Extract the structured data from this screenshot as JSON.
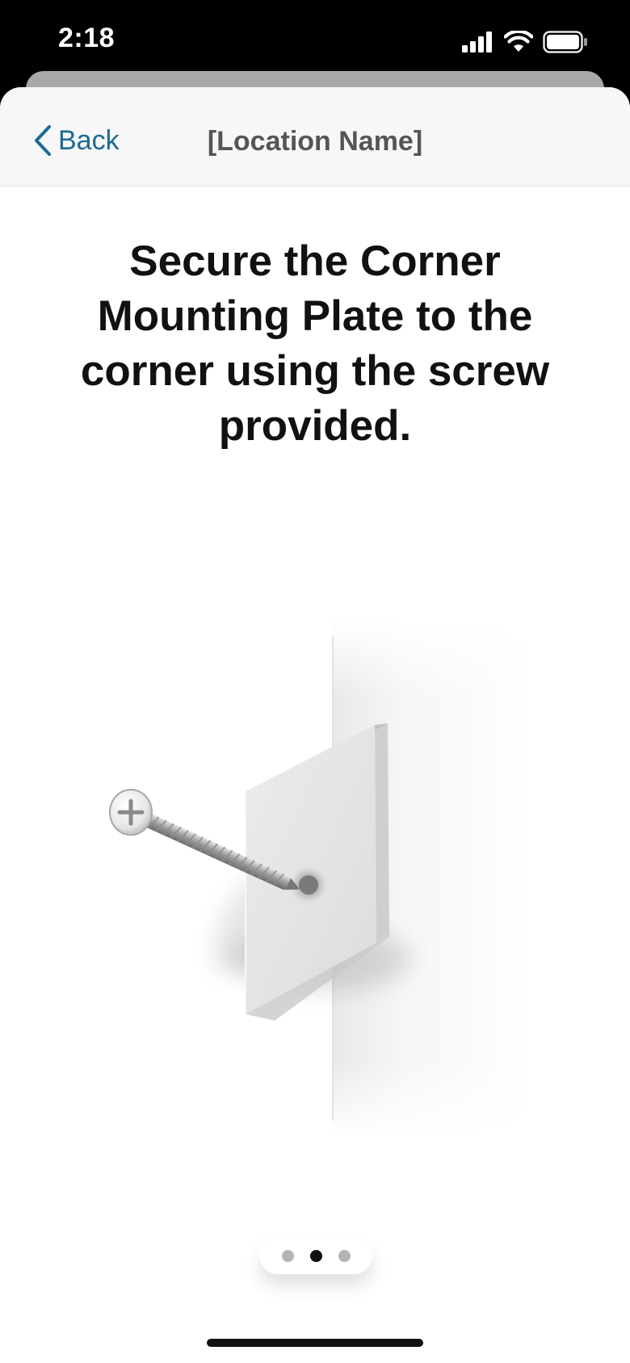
{
  "status_bar": {
    "time": "2:18",
    "icons": [
      "cellular-signal-icon",
      "wifi-icon",
      "battery-icon"
    ]
  },
  "nav": {
    "back_label": "Back",
    "title": "[Location Name]"
  },
  "main": {
    "headline": "Secure the Corner Mounting Plate to the corner using the screw provided.",
    "illustration": "corner-mounting-plate-screw-illustration"
  },
  "pager": {
    "page_count": 3,
    "current_page": 2
  },
  "colors": {
    "accent": "#1d6a93",
    "status_bar_bg": "#000000",
    "nav_bg": "#f7f7f7",
    "title_text": "#111111"
  }
}
